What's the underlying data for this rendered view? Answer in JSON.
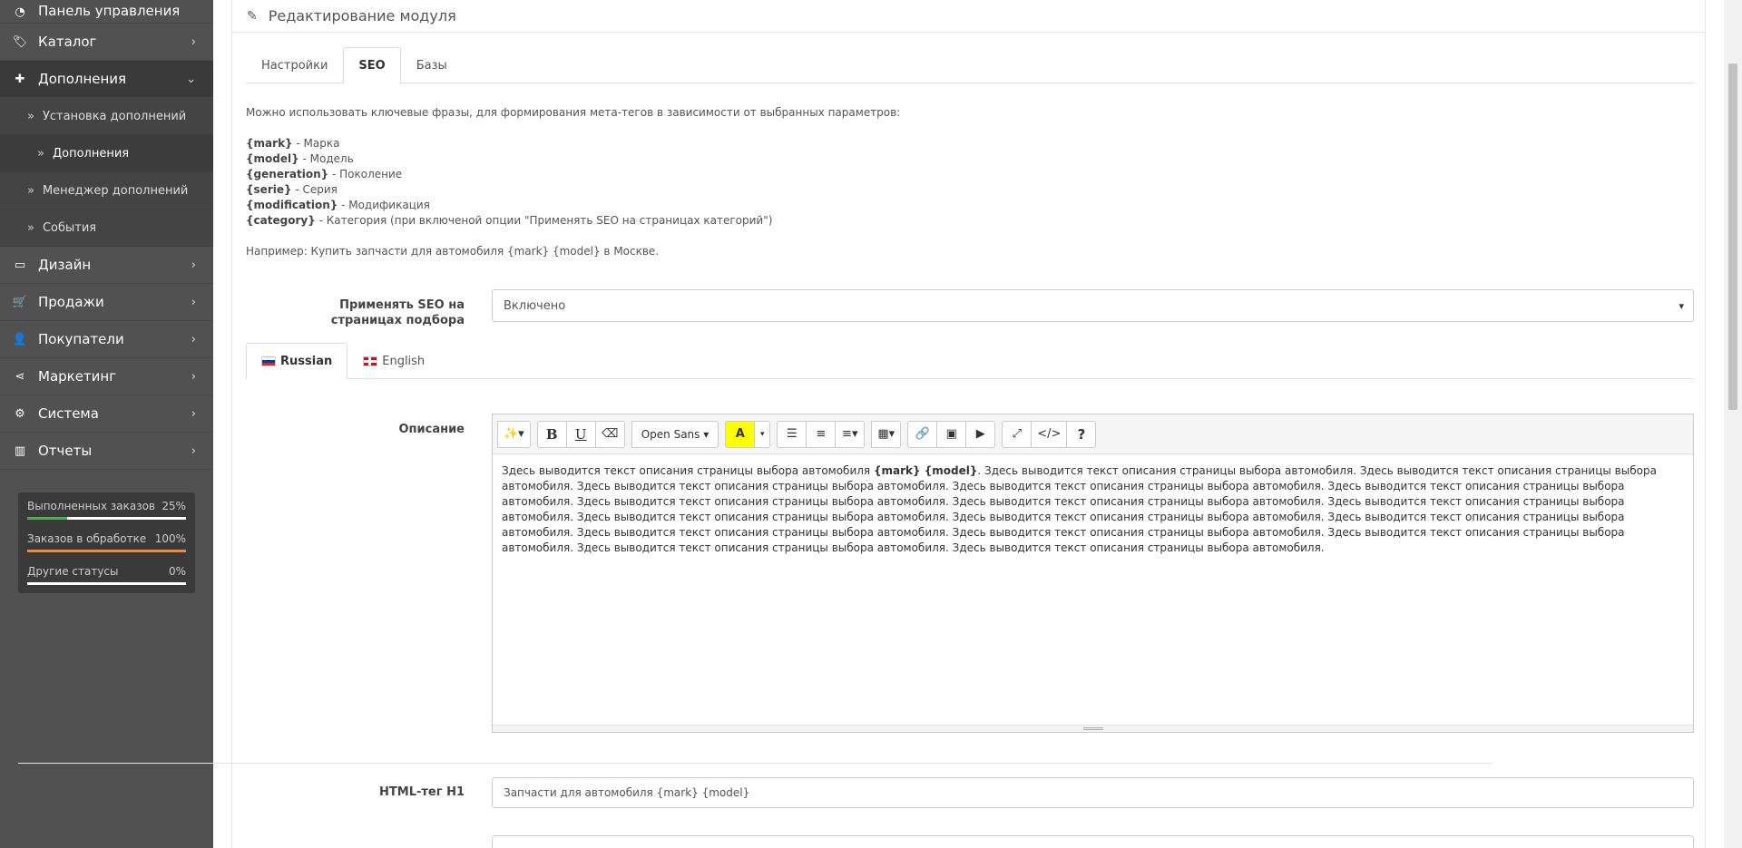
{
  "sidebar": {
    "items": [
      {
        "label": "Панель управления",
        "icon": "dashboard-icon"
      },
      {
        "label": "Каталог",
        "icon": "tags-icon"
      },
      {
        "label": "Дополнения",
        "icon": "puzzle-icon"
      },
      {
        "label": "Дизайн",
        "icon": "desktop-icon"
      },
      {
        "label": "Продажи",
        "icon": "cart-icon"
      },
      {
        "label": "Покупатели",
        "icon": "user-icon"
      },
      {
        "label": "Маркетинг",
        "icon": "share-icon"
      },
      {
        "label": "Система",
        "icon": "cog-icon"
      },
      {
        "label": "Отчеты",
        "icon": "bar-chart-icon"
      }
    ],
    "subitems": [
      {
        "label": "Установка дополнений"
      },
      {
        "label": "Дополнения"
      },
      {
        "label": "Менеджер дополнений"
      },
      {
        "label": "События"
      }
    ],
    "stats": [
      {
        "label": "Выполненных заказов",
        "value": "25%",
        "fraction": 0.25,
        "color": "#4caf50"
      },
      {
        "label": "Заказов в обработке",
        "value": "100%",
        "fraction": 1.0,
        "color": "#f0883e"
      },
      {
        "label": "Другие статусы",
        "value": "0%",
        "fraction": 0.0,
        "color": "#d9534f"
      }
    ]
  },
  "panel": {
    "title": "Редактирование модуля"
  },
  "tabs": [
    {
      "label": "Настройки"
    },
    {
      "label": "SEO"
    },
    {
      "label": "Базы"
    }
  ],
  "help": {
    "intro": "Можно использовать ключевые фразы, для формирования мета-тегов в зависимости от выбранных параметров:",
    "keys": [
      {
        "key": "{mark}",
        "desc": " - Марка"
      },
      {
        "key": "{model}",
        "desc": " - Модель"
      },
      {
        "key": "{generation}",
        "desc": " - Поколение"
      },
      {
        "key": "{serie}",
        "desc": " - Серия"
      },
      {
        "key": "{modification}",
        "desc": " - Модификация"
      },
      {
        "key": "{category}",
        "desc": " - Категория (при включеной опции \"Применять SEO на страницах категорий\")"
      }
    ],
    "example": "Например: Купить запчасти для автомобиля {mark} {model} в Москве."
  },
  "seo_apply": {
    "label": "Применять SEO на страницах подбора",
    "value": "Включено"
  },
  "lang_tabs": [
    {
      "label": "Russian"
    },
    {
      "label": "English"
    }
  ],
  "description": {
    "label": "Описание",
    "font": "Open Sans",
    "text_start": "Здесь выводится текст описания страницы выбора автомобиля ",
    "text_bold": "{mark} {model}",
    "text_rest": ". Здесь выводится текст описания страницы выбора автомобиля. Здесь выводится текст описания страницы выбора автомобиля. Здесь выводится текст описания страницы выбора автомобиля. Здесь выводится текст описания страницы выбора автомобиля. Здесь выводится текст описания страницы выбора автомобиля. Здесь выводится текст описания страницы выбора автомобиля. Здесь выводится текст описания страницы выбора автомобиля. Здесь выводится текст описания страницы выбора автомобиля. Здесь выводится текст описания страницы выбора автомобиля. Здесь выводится текст описания страницы выбора автомобиля. Здесь выводится текст описания страницы выбора автомобиля. Здесь выводится текст описания страницы выбора автомобиля. Здесь выводится текст описания страницы выбора автомобиля. Здесь выводится текст описания страницы выбора автомобиля. Здесь выводится текст описания страницы выбора автомобиля. Здесь выводится текст описания страницы выбора автомобиля."
  },
  "h1": {
    "label": "HTML-тег H1",
    "value": "Запчасти для автомобиля {mark} {model}"
  }
}
